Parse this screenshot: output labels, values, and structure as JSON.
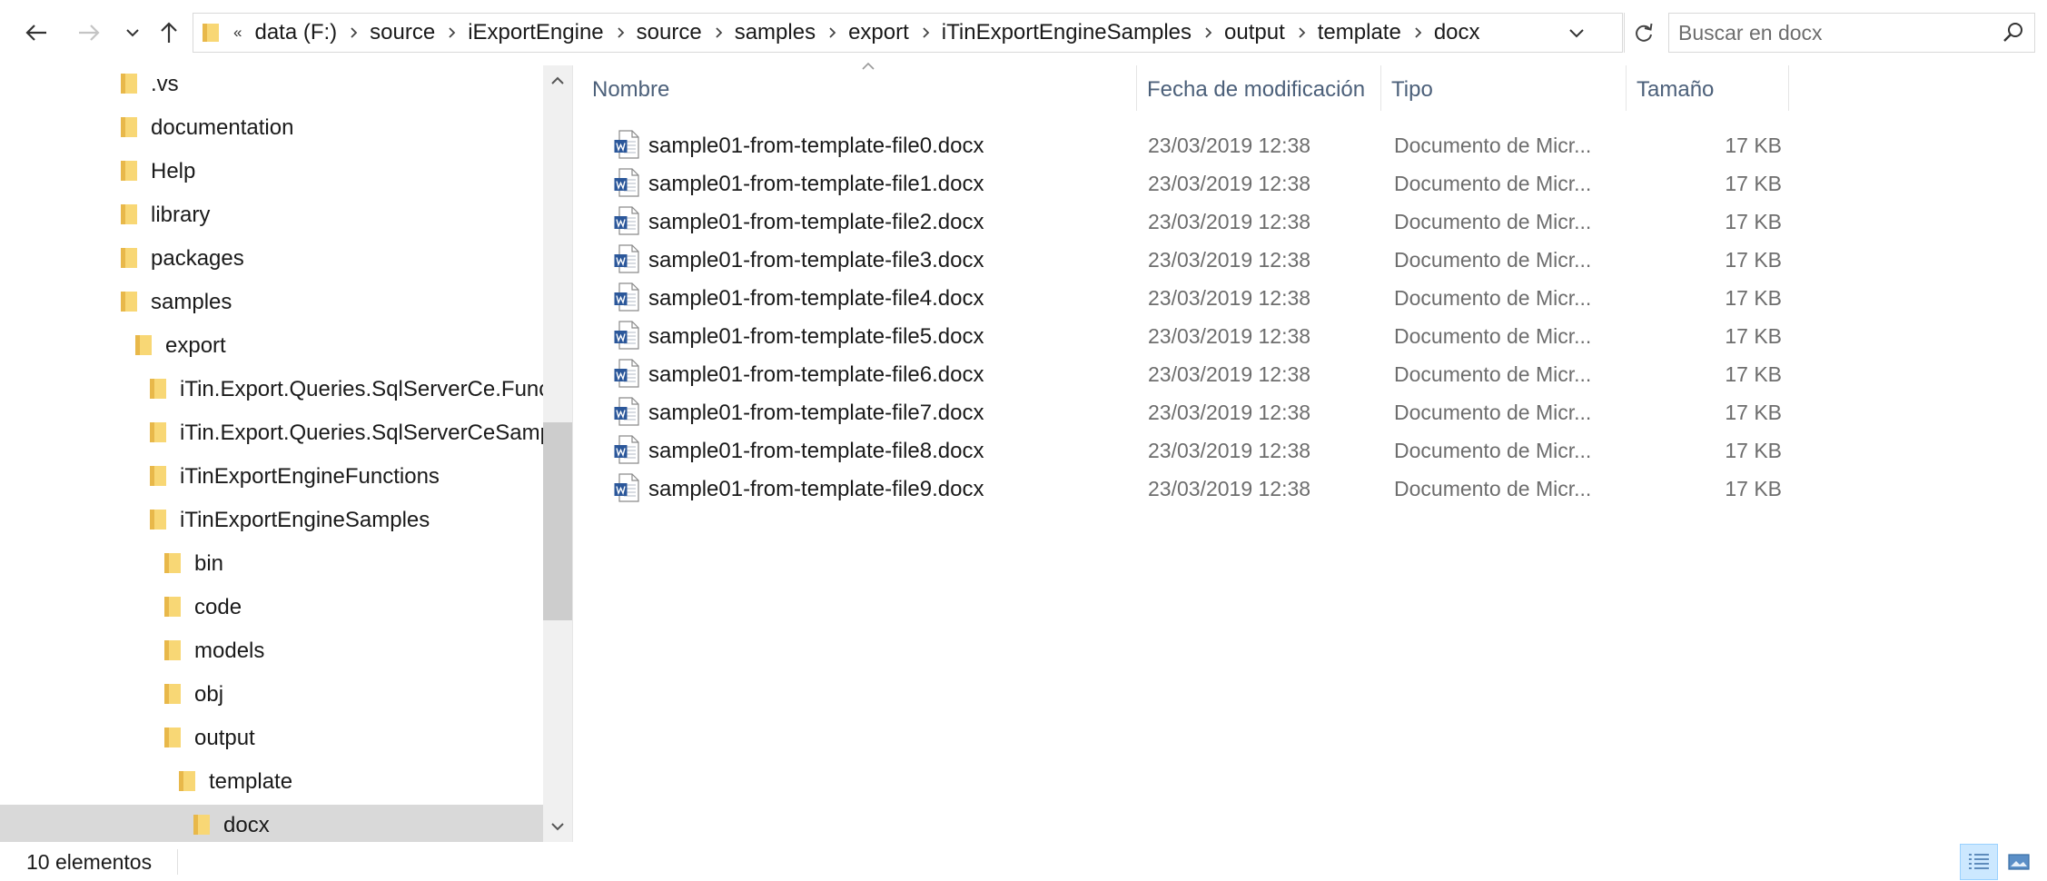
{
  "navigation": {
    "back_icon": "arrow-left-icon",
    "forward_icon": "arrow-right-icon",
    "recent_icon": "chevron-down-icon",
    "up_icon": "arrow-up-icon"
  },
  "address_bar": {
    "overflow": "«",
    "breadcrumbs": [
      "data (F:)",
      "source",
      "iExportEngine",
      "source",
      "samples",
      "export",
      "iTinExportEngineSamples",
      "output",
      "template",
      "docx"
    ]
  },
  "search": {
    "placeholder": "Buscar en docx"
  },
  "tree": {
    "items": [
      {
        "label": ".vs"
      },
      {
        "label": "documentation"
      },
      {
        "label": "Help"
      },
      {
        "label": "library"
      },
      {
        "label": "packages"
      },
      {
        "label": "samples"
      },
      {
        "label": "export"
      },
      {
        "label": "iTin.Export.Queries.SqlServerCe.Functions"
      },
      {
        "label": "iTin.Export.Queries.SqlServerCeSamples"
      },
      {
        "label": "iTinExportEngineFunctions"
      },
      {
        "label": "iTinExportEngineSamples"
      },
      {
        "label": "bin"
      },
      {
        "label": "code"
      },
      {
        "label": "models"
      },
      {
        "label": "obj"
      },
      {
        "label": "output"
      },
      {
        "label": "template"
      },
      {
        "label": "docx"
      }
    ]
  },
  "columns": {
    "name": "Nombre",
    "date": "Fecha de modificación",
    "type": "Tipo",
    "size": "Tamaño"
  },
  "files": [
    {
      "name": "sample01-from-template-file0.docx",
      "date": "23/03/2019 12:38",
      "type": "Documento de Micr...",
      "size": "17 KB"
    },
    {
      "name": "sample01-from-template-file1.docx",
      "date": "23/03/2019 12:38",
      "type": "Documento de Micr...",
      "size": "17 KB"
    },
    {
      "name": "sample01-from-template-file2.docx",
      "date": "23/03/2019 12:38",
      "type": "Documento de Micr...",
      "size": "17 KB"
    },
    {
      "name": "sample01-from-template-file3.docx",
      "date": "23/03/2019 12:38",
      "type": "Documento de Micr...",
      "size": "17 KB"
    },
    {
      "name": "sample01-from-template-file4.docx",
      "date": "23/03/2019 12:38",
      "type": "Documento de Micr...",
      "size": "17 KB"
    },
    {
      "name": "sample01-from-template-file5.docx",
      "date": "23/03/2019 12:38",
      "type": "Documento de Micr...",
      "size": "17 KB"
    },
    {
      "name": "sample01-from-template-file6.docx",
      "date": "23/03/2019 12:38",
      "type": "Documento de Micr...",
      "size": "17 KB"
    },
    {
      "name": "sample01-from-template-file7.docx",
      "date": "23/03/2019 12:38",
      "type": "Documento de Micr...",
      "size": "17 KB"
    },
    {
      "name": "sample01-from-template-file8.docx",
      "date": "23/03/2019 12:38",
      "type": "Documento de Micr...",
      "size": "17 KB"
    },
    {
      "name": "sample01-from-template-file9.docx",
      "date": "23/03/2019 12:38",
      "type": "Documento de Micr...",
      "size": "17 KB"
    }
  ],
  "status": {
    "item_count": "10 elementos"
  },
  "colors": {
    "folder": "#f8d775",
    "folder_dark": "#e8b84a",
    "word_blue": "#2b579a",
    "header_text": "#4c607a",
    "selected_bg": "#d9d9d9"
  }
}
